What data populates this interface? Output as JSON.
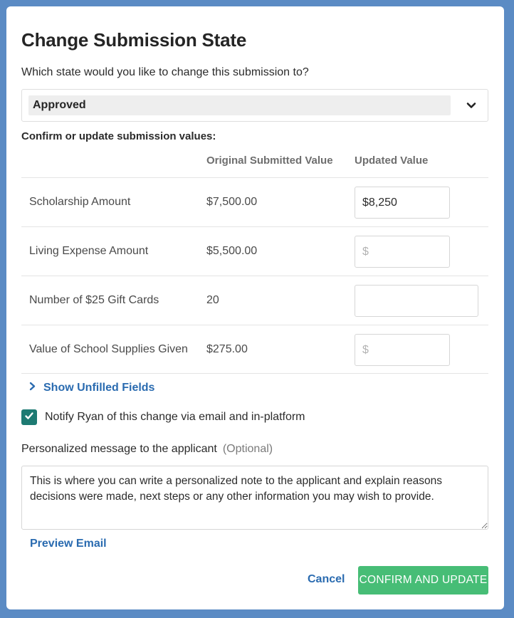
{
  "dialog": {
    "title": "Change Submission State",
    "question": "Which state would you like to change this submission to?",
    "state_select": {
      "value": "Approved"
    },
    "confirm_label": "Confirm or update submission values:"
  },
  "table": {
    "headers": {
      "field": "",
      "original": "Original Submitted Value",
      "updated": "Updated Value"
    },
    "rows": [
      {
        "label": "Scholarship Amount",
        "original": "$7,500.00",
        "updated_value": "$8,250",
        "placeholder": ""
      },
      {
        "label": "Living Expense Amount",
        "original": "$5,500.00",
        "updated_value": "",
        "placeholder": "$"
      },
      {
        "label": "Number of $25 Gift Cards",
        "original": "20",
        "updated_value": "",
        "placeholder": ""
      },
      {
        "label": "Value of School Supplies Given",
        "original": "$275.00",
        "updated_value": "",
        "placeholder": "$"
      }
    ]
  },
  "show_unfilled": "Show Unfilled Fields",
  "notify": {
    "checked": true,
    "label": "Notify Ryan of this change via email and in-platform"
  },
  "message": {
    "label": "Personalized message to the applicant",
    "optional": "(Optional)",
    "value": "This is where you can write a personalized note to the applicant and explain reasons decisions were made, next steps or any other information you may wish to provide."
  },
  "preview_email": "Preview Email",
  "actions": {
    "cancel": "Cancel",
    "confirm": "CONFIRM AND UPDATE"
  },
  "colors": {
    "backdrop": "#5b8bc4",
    "link": "#2a6bb0",
    "checkbox": "#1d7a72",
    "confirm": "#47bd76"
  },
  "icons": {
    "select": "chevron-down-icon",
    "unfilled": "chevron-right-icon",
    "checkbox": "check-icon"
  }
}
